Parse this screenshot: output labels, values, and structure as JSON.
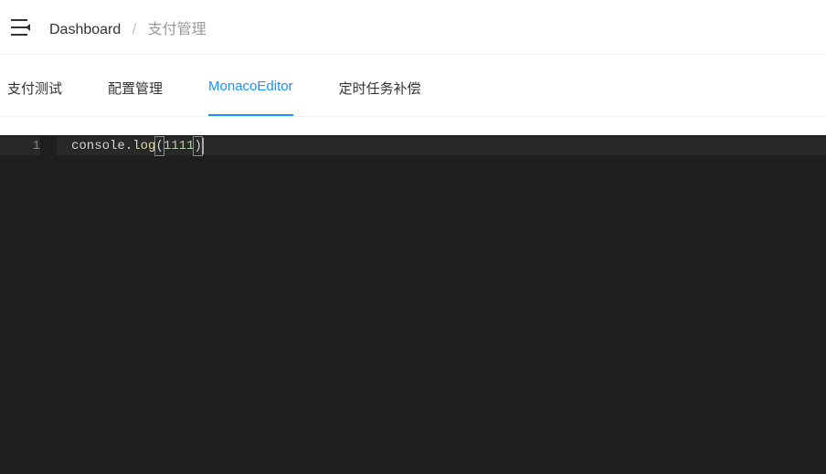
{
  "header": {
    "breadcrumb": {
      "root": "Dashboard",
      "separator": "/",
      "current": "支付管理"
    }
  },
  "tabs": [
    {
      "label": "支付测试",
      "active": false
    },
    {
      "label": "配置管理",
      "active": false
    },
    {
      "label": "MonacoEditor",
      "active": true
    },
    {
      "label": "定时任务补偿",
      "active": false
    }
  ],
  "editor": {
    "lines": [
      {
        "number": "1",
        "tokens": {
          "obj": "console",
          "dot": ".",
          "method": "log",
          "open": "(",
          "arg": "1111",
          "close": ")"
        }
      }
    ]
  }
}
